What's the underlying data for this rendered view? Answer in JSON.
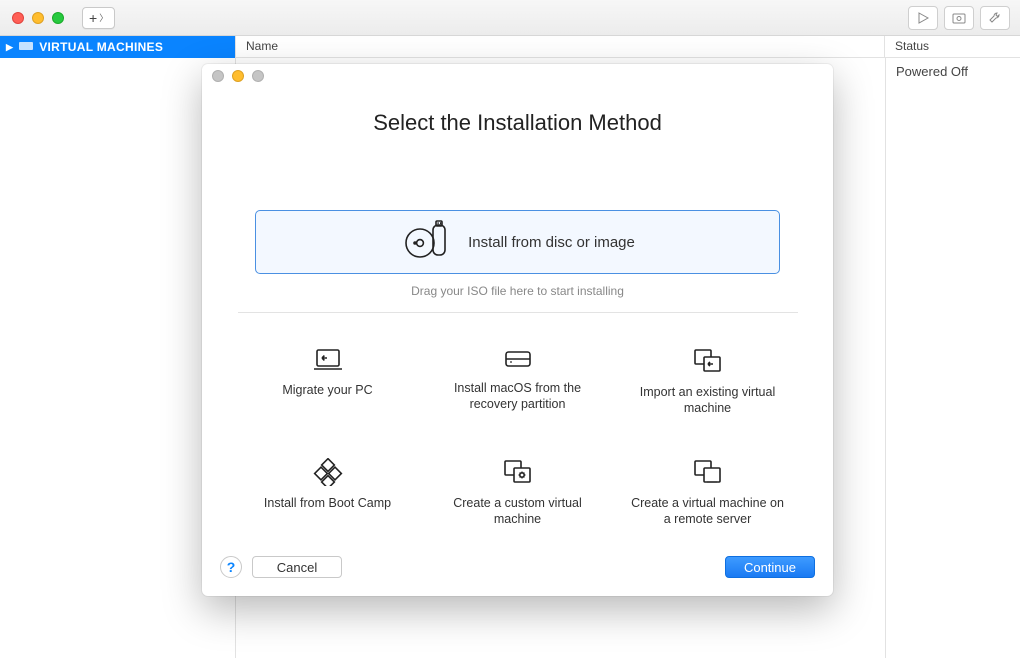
{
  "sidebar": {
    "heading": "VIRTUAL MACHINES"
  },
  "columns": {
    "name": "Name",
    "status": "Status"
  },
  "row": {
    "status": "Powered Off"
  },
  "modal": {
    "title": "Select the Installation Method",
    "primary_option": "Install from disc or image",
    "drag_hint": "Drag your ISO file here to start installing",
    "options": [
      "Migrate your PC",
      "Install macOS from the recovery partition",
      "Import an existing virtual machine",
      "Install from Boot Camp",
      "Create a custom virtual machine",
      "Create a virtual machine on a remote server"
    ],
    "cancel": "Cancel",
    "continue": "Continue",
    "help": "?"
  }
}
